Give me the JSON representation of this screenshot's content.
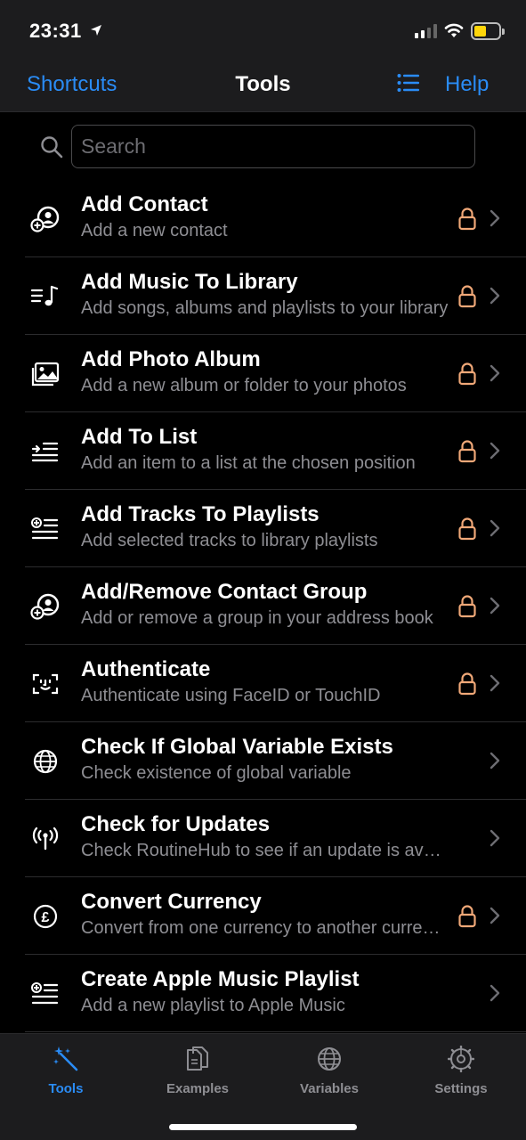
{
  "status_bar": {
    "time": "23:31"
  },
  "nav": {
    "back_label": "Shortcuts",
    "title": "Tools",
    "help_label": "Help"
  },
  "search": {
    "placeholder": "Search",
    "value": ""
  },
  "accent_color": "#2a8cf6",
  "lock_color": "#f0a878",
  "items": [
    {
      "icon": "add-contact-icon",
      "title": "Add Contact",
      "subtitle": "Add a new contact",
      "locked": true
    },
    {
      "icon": "music-list-icon",
      "title": "Add Music To Library",
      "subtitle": "Add songs, albums and playlists to your library",
      "locked": true
    },
    {
      "icon": "photo-album-icon",
      "title": "Add Photo Album",
      "subtitle": "Add a new album or folder to your photos",
      "locked": true
    },
    {
      "icon": "add-to-list-icon",
      "title": "Add To List",
      "subtitle": "Add an item to a list at the chosen position",
      "locked": true
    },
    {
      "icon": "add-tracks-icon",
      "title": "Add Tracks To Playlists",
      "subtitle": "Add selected tracks to library playlists",
      "locked": true
    },
    {
      "icon": "contact-group-icon",
      "title": "Add/Remove Contact Group",
      "subtitle": "Add or remove a group in your address book",
      "locked": true
    },
    {
      "icon": "face-id-icon",
      "title": "Authenticate",
      "subtitle": "Authenticate using FaceID or TouchID",
      "locked": true
    },
    {
      "icon": "globe-icon",
      "title": "Check If Global Variable Exists",
      "subtitle": "Check existence of global variable",
      "locked": false
    },
    {
      "icon": "antenna-icon",
      "title": "Check for Updates",
      "subtitle": "Check RoutineHub to see if an update is available",
      "locked": false
    },
    {
      "icon": "pound-currency-icon",
      "title": "Convert Currency",
      "subtitle": "Convert from one currency to another currency",
      "locked": true
    },
    {
      "icon": "add-playlist-icon",
      "title": "Create Apple Music Playlist",
      "subtitle": "Add a new playlist to Apple Music",
      "locked": false
    }
  ],
  "tabs": [
    {
      "icon": "magic-wand-icon",
      "label": "Tools",
      "active": true
    },
    {
      "icon": "documents-icon",
      "label": "Examples",
      "active": false
    },
    {
      "icon": "globe-icon",
      "label": "Variables",
      "active": false
    },
    {
      "icon": "gear-icon",
      "label": "Settings",
      "active": false
    }
  ]
}
